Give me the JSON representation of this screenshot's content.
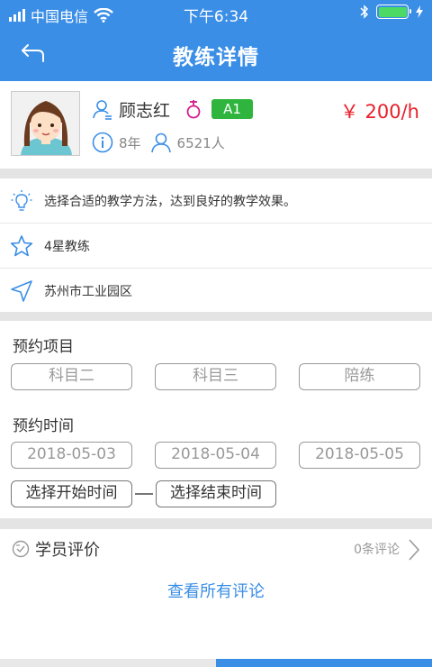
{
  "status_bar": {
    "carrier": "中国电信",
    "time": "下午6:34"
  },
  "nav": {
    "title": "教练详情"
  },
  "coach": {
    "name": "顾志红",
    "license": "A1",
    "price": "￥ 200/h",
    "years": "8年",
    "students": "6521人"
  },
  "info": {
    "motto": "选择合适的教学方法，达到良好的教学效果。",
    "rating": "4星教练",
    "location": "苏州市工业园区"
  },
  "booking": {
    "project_label": "预约项目",
    "projects": [
      "科目二",
      "科目三",
      "陪练"
    ],
    "date_label": "预约时间",
    "dates": [
      "2018-05-03",
      "2018-05-04",
      "2018-05-05"
    ],
    "start_time": "选择开始时间",
    "end_time": "选择结束时间"
  },
  "reviews": {
    "title": "学员评价",
    "count": "0条评论",
    "view_all": "查看所有评论"
  },
  "colors": {
    "primary": "#3a8ee6",
    "price": "#e8202a",
    "license_badge": "#2fb53d"
  }
}
